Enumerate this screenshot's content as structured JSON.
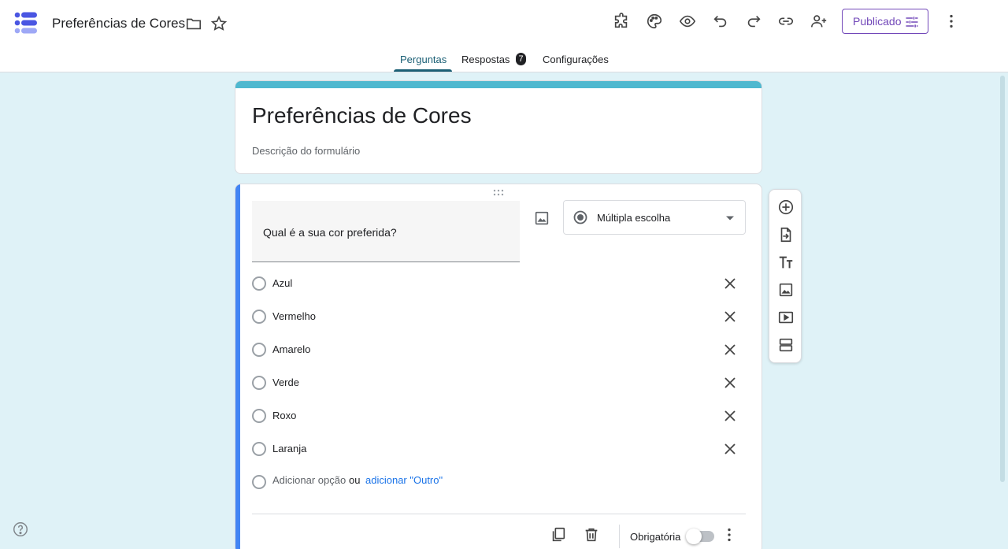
{
  "app": {
    "title": "Preferências de Cores",
    "publish_label": "Publicado"
  },
  "tabs": [
    {
      "label": "Perguntas",
      "active": true
    },
    {
      "label": "Respostas",
      "badge": "7"
    },
    {
      "label": "Configurações"
    }
  ],
  "form": {
    "title": "Preferências de Cores",
    "description_placeholder": "Descrição do formulário"
  },
  "question": {
    "title": "Qual é a sua cor preferida?",
    "type": "Múltipla escolha",
    "options": [
      "Azul",
      "Vermelho",
      "Amarelo",
      "Verde",
      "Roxo",
      "Laranja"
    ],
    "add_option": "Adicionar opção",
    "or_text": "ou",
    "add_other": "adicionar \"Outro\"",
    "required_label": "Obrigatória",
    "required": false
  },
  "colors": {
    "accent": "#4285f4",
    "header_band": "#4fb8cf",
    "background": "#dff2f7",
    "publish": "#7248b9"
  },
  "icons": {
    "header": [
      "folder-icon",
      "star-icon",
      "addons-icon",
      "palette-icon",
      "preview-icon",
      "undo-icon",
      "redo-icon",
      "link-icon",
      "add-collaborator-icon",
      "more-vert-icon"
    ],
    "toolbar": [
      "add-question-icon",
      "import-questions-icon",
      "add-title-icon",
      "add-image-icon",
      "add-video-icon",
      "add-section-icon"
    ]
  }
}
